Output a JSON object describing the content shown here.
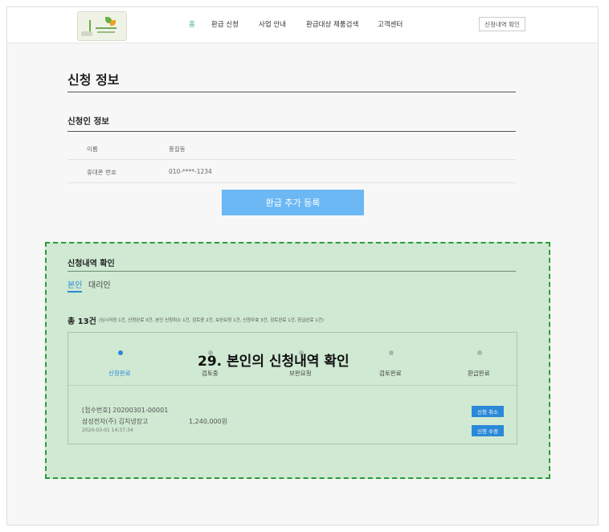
{
  "header": {
    "nav": [
      "홈",
      "환급 신청",
      "사업 안내",
      "환급대상 제품검색",
      "고객센터"
    ],
    "check_button": "신청내역 확인"
  },
  "page": {
    "title": "신청 정보",
    "applicant_section": "신청인 정보",
    "fields": [
      {
        "label": "이름",
        "value": "홍길동"
      },
      {
        "label": "휴대폰 번호",
        "value": "010-****-1234"
      }
    ],
    "add_button": "환급 추가 등록"
  },
  "history": {
    "title": "신청내역 확인",
    "tabs": [
      "본인",
      "대리인"
    ],
    "total": "총 13건",
    "total_detail": "(임시저장 1건, 신청완료 3건, 본인 신청취소 1건, 검토중 2건, 보완요청 1건, 신청무효 3건, 검토완료 1건, 환급완료 1건)",
    "steps": [
      "신청완료",
      "검토중",
      "보완요청",
      "검토완료",
      "환급완료"
    ],
    "active_step": 0,
    "item": {
      "receipt": "[접수번호] 20200301-00001",
      "product": "삼성전자(주)   김치냉장고",
      "amount": "1,240,000원",
      "datetime": "2020-03-01 14:37:34",
      "cancel_button": "신청 취소",
      "edit_button": "신청 수정"
    }
  },
  "annotation": "29. 본인의 신청내역 확인",
  "colors": {
    "accent": "#2a88d8",
    "nav_active": "#2fb36b",
    "highlight_bg": "#cfe9d2",
    "highlight_border": "#2e9a3c",
    "add_button": "#6bb8f5"
  }
}
